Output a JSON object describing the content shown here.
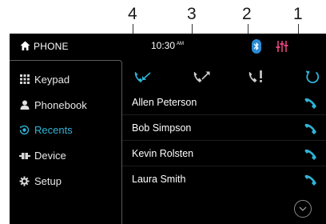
{
  "callouts": [
    "4",
    "3",
    "2",
    "1"
  ],
  "status_bar": {
    "title": "PHONE",
    "time": "10:30",
    "ampm": "AM",
    "home_icon": "home-icon",
    "bluetooth_icon": "bluetooth-icon",
    "eq_icon": "equalizer-icon"
  },
  "sidebar": {
    "items": [
      {
        "label": "Keypad",
        "icon": "keypad-icon",
        "active": false
      },
      {
        "label": "Phonebook",
        "icon": "person-icon",
        "active": false
      },
      {
        "label": "Recents",
        "icon": "recents-icon",
        "active": true
      },
      {
        "label": "Device",
        "icon": "device-icon",
        "active": false
      },
      {
        "label": "Setup",
        "icon": "gear-icon",
        "active": false
      }
    ]
  },
  "filters": [
    {
      "name": "incoming-calls-filter",
      "icon": "incoming-call-icon",
      "selected": true
    },
    {
      "name": "outgoing-calls-filter",
      "icon": "outgoing-call-icon",
      "selected": false
    },
    {
      "name": "missed-calls-filter",
      "icon": "missed-call-icon",
      "selected": false
    },
    {
      "name": "all-calls-filter",
      "icon": "refresh-icon",
      "selected": true
    }
  ],
  "recents": [
    {
      "name": "Allen Peterson",
      "icon": "call-icon"
    },
    {
      "name": "Bob Simpson",
      "icon": "call-icon"
    },
    {
      "name": "Kevin Rolsten",
      "icon": "call-icon"
    },
    {
      "name": "Laura Smith",
      "icon": "call-icon"
    }
  ],
  "scroll_icon": "chevron-down-icon",
  "colors": {
    "accent": "#2fb4d6",
    "background": "#000000",
    "bluetooth": "#2a8bd4",
    "eq": "#e0457b",
    "text": "#ffffff",
    "inactive_icon": "#cfcfcf"
  }
}
